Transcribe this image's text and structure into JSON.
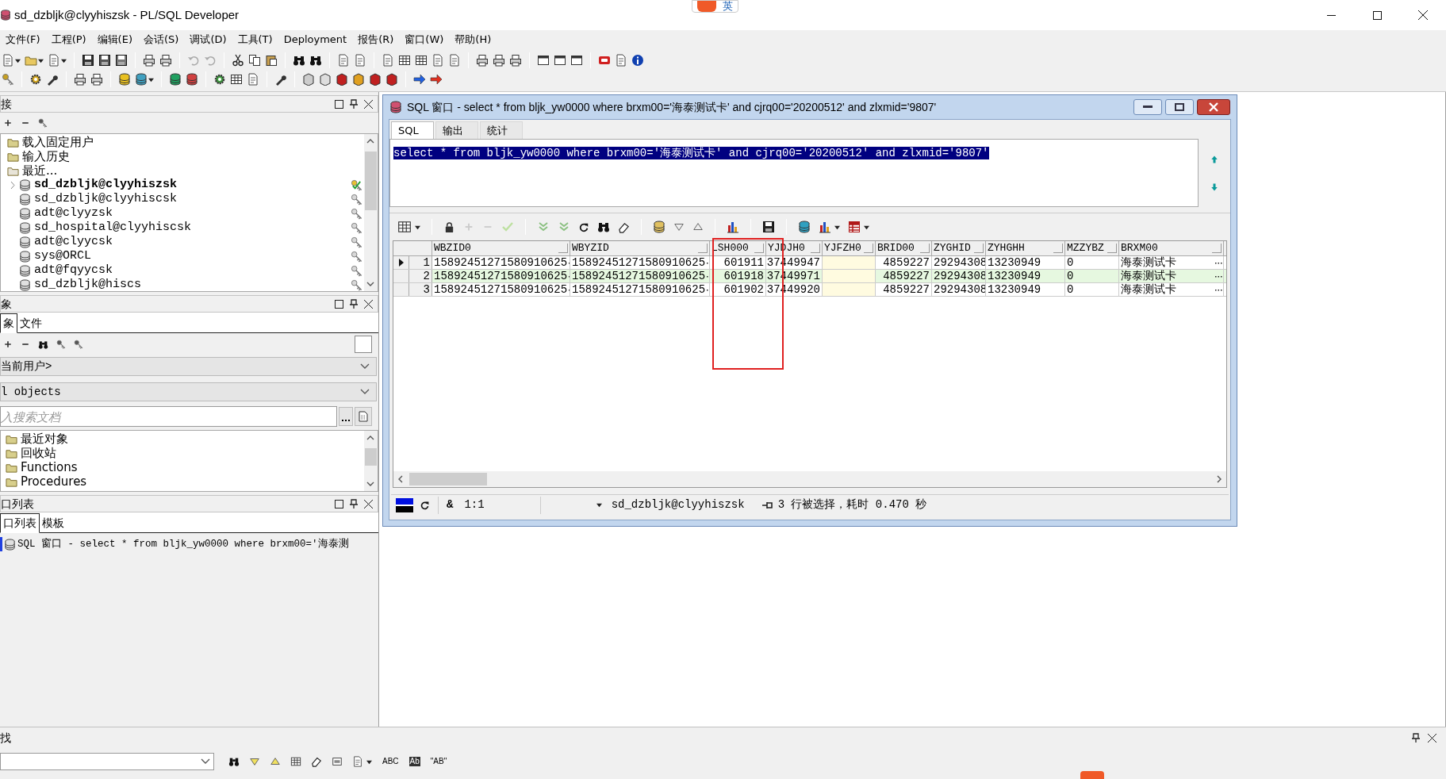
{
  "window": {
    "title": "sd_dzbljk@clyyhiszsk - PL/SQL Developer"
  },
  "ime_bar": {
    "label": "英"
  },
  "menu": [
    "文件(F)",
    "工程(P)",
    "编辑(E)",
    "会话(S)",
    "调试(D)",
    "工具(T)",
    "Deployment",
    "报告(R)",
    "窗口(W)",
    "帮助(H)"
  ],
  "connections_panel": {
    "title": "接",
    "tree": [
      {
        "label": "载入固定用户",
        "kind": "folder"
      },
      {
        "label": "输入历史",
        "kind": "folder"
      },
      {
        "label": "最近...",
        "kind": "recent",
        "children": [
          {
            "label": "sd_dzbljk@clyyhiszsk",
            "kind": "connection",
            "active": true,
            "expanded": false
          },
          {
            "label": "sd_dzbljk@clyyhiscsk",
            "kind": "connection",
            "active": false
          },
          {
            "label": "adt@clyyzsk",
            "kind": "connection",
            "active": false
          },
          {
            "label": "sd_hospital@clyyhiscsk",
            "kind": "connection",
            "active": false
          },
          {
            "label": "adt@clyycsk",
            "kind": "connection",
            "active": false
          },
          {
            "label": "sys@ORCL",
            "kind": "connection",
            "active": false
          },
          {
            "label": "adt@fqyycsk",
            "kind": "connection",
            "active": false
          },
          {
            "label": "sd_dzbljk@hiscs",
            "kind": "connection",
            "active": false
          }
        ]
      }
    ]
  },
  "objects_panel": {
    "title": "象",
    "tabs": [
      {
        "label": "象",
        "selected": true
      },
      {
        "label": "文件",
        "selected": false
      }
    ],
    "owner_dropdown": "当前用户>",
    "type_dropdown": "l objects",
    "search": {
      "placeholder": "入搜索文档"
    },
    "tree": [
      {
        "label": "最近对象"
      },
      {
        "label": "回收站"
      },
      {
        "label": "Functions"
      },
      {
        "label": "Procedures"
      }
    ]
  },
  "window_list_panel": {
    "title": "口列表",
    "tabs": [
      {
        "label": "口列表",
        "selected": true
      },
      {
        "label": "模板",
        "selected": false
      }
    ],
    "items": [
      {
        "label": "SQL 窗口 - select * from bljk_yw0000 where brxm00='海泰测",
        "selected": true
      }
    ]
  },
  "sql_window": {
    "title": "SQL 窗口 - select * from bljk_yw0000 where brxm00='海泰测试卡' and cjrq00='20200512' and zlxmid='9807'",
    "tabs": [
      {
        "label": "SQL",
        "selected": true
      },
      {
        "label": "输出",
        "selected": false
      },
      {
        "label": "统计",
        "selected": false
      }
    ],
    "editor": {
      "text": "select * from bljk_yw0000 where brxm00='海泰测试卡' and cjrq00='20200512' and zlxmid='9807'",
      "selected": true
    },
    "grid": {
      "columns": [
        {
          "label": "WBZID0",
          "kind": "long"
        },
        {
          "label": "WBYZID",
          "kind": "long"
        },
        {
          "label": "LSH000",
          "kind": "number"
        },
        {
          "label": "YJDJH0",
          "kind": "number"
        },
        {
          "label": "YJFZH0",
          "kind": "text"
        },
        {
          "label": "BRID00",
          "kind": "number"
        },
        {
          "label": "ZYGHID",
          "kind": "text"
        },
        {
          "label": "ZYHGHH",
          "kind": "text"
        },
        {
          "label": "MZZYBZ",
          "kind": "text"
        },
        {
          "label": "BRXM00",
          "kind": "long"
        }
      ],
      "rows": [
        {
          "number": "1",
          "current": true,
          "alternate": false,
          "cells": [
            "15892451271580910625",
            "15892451271580910625",
            "601911",
            "37449947",
            null,
            "4859227",
            "29294308",
            "13230949",
            "0",
            "海泰测试卡"
          ]
        },
        {
          "number": "2",
          "current": false,
          "alternate": true,
          "cells": [
            "15892451271580910625",
            "15892451271580910625",
            "601918",
            "37449971",
            null,
            "4859227",
            "29294308",
            "13230949",
            "0",
            "海泰测试卡"
          ]
        },
        {
          "number": "3",
          "current": false,
          "alternate": false,
          "cells": [
            "15892451271580910625",
            "15892451271580910625",
            "601902",
            "37449920",
            null,
            "4859227",
            "29294308",
            "13230949",
            "0",
            "海泰测试卡"
          ]
        }
      ]
    },
    "status_bar": {
      "mode": "&",
      "position": "1:1",
      "connection": "sd_dzbljk@clyyhiszsk",
      "message": "3 行被选择，耗时 0.470 秒"
    }
  },
  "find_panel": {
    "title": "找",
    "options": [
      "ABC",
      "Ab",
      "\"AB\""
    ]
  }
}
